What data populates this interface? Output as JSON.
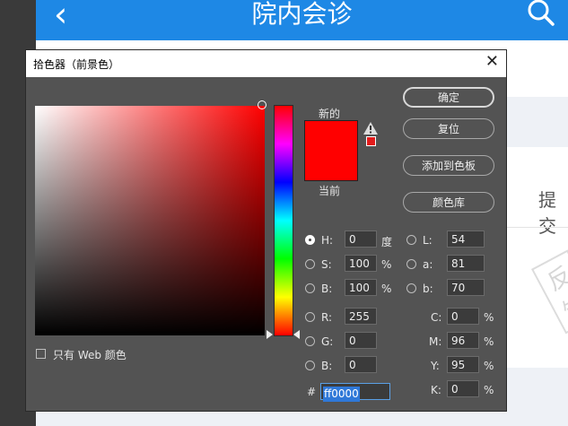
{
  "app": {
    "title": "院内会诊",
    "back_icon": "‹",
    "submit_text": "提交",
    "feedback_text": "反馈"
  },
  "dialog": {
    "title": "拾色器（前景色）",
    "close": "✕",
    "new_label": "新的",
    "current_label": "当前",
    "current_color": "#ff0000",
    "new_color": "#ff0000",
    "buttons": {
      "ok": "确定",
      "reset": "复位",
      "add_swatch": "添加到色板",
      "libraries": "颜色库"
    },
    "hsb": {
      "h_label": "H:",
      "h_value": "0",
      "h_unit": "度",
      "s_label": "S:",
      "s_value": "100",
      "s_unit": "%",
      "b_label": "B:",
      "b_value": "100",
      "b_unit": "%"
    },
    "rgb": {
      "r_label": "R:",
      "r_value": "255",
      "g_label": "G:",
      "g_value": "0",
      "b_label": "B:",
      "b_value": "0"
    },
    "lab": {
      "l_label": "L:",
      "l_value": "54",
      "a_label": "a:",
      "a_value": "81",
      "b_label": "b:",
      "b_value": "70"
    },
    "cmyk": {
      "c_label": "C:",
      "c_value": "0",
      "m_label": "M:",
      "m_value": "96",
      "y_label": "Y:",
      "y_value": "95",
      "k_label": "K:",
      "k_value": "0",
      "unit": "%"
    },
    "hex_label": "#",
    "hex_value": "ff0000",
    "web_only_label": "只有 Web 颜色"
  }
}
